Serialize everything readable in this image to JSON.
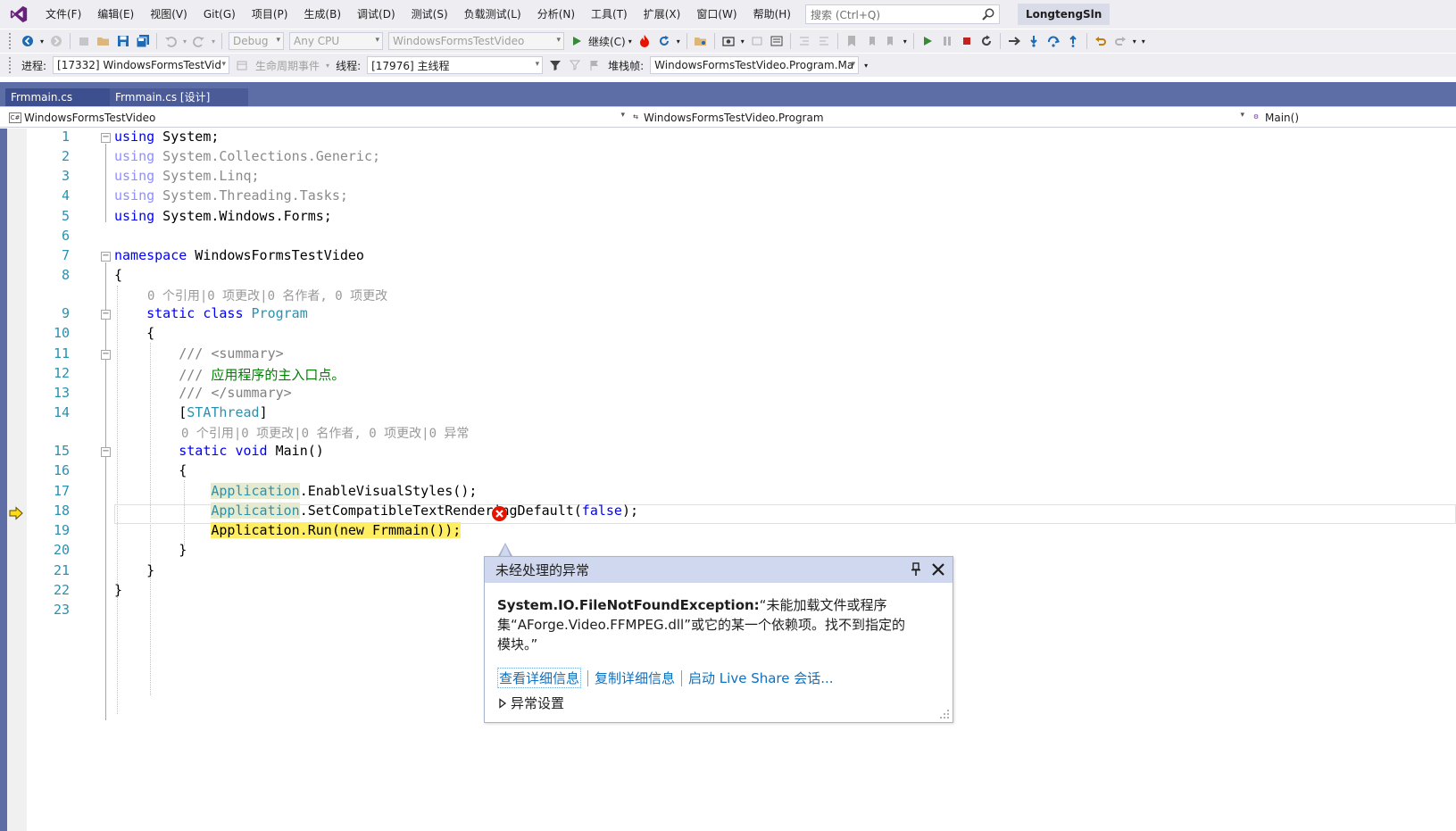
{
  "menu": [
    "文件(F)",
    "编辑(E)",
    "视图(V)",
    "Git(G)",
    "项目(P)",
    "生成(B)",
    "调试(D)",
    "测试(S)",
    "负载测试(L)",
    "分析(N)",
    "工具(T)",
    "扩展(X)",
    "窗口(W)",
    "帮助(H)"
  ],
  "search": {
    "placeholder": "搜索 (Ctrl+Q)"
  },
  "solution_name": "LongtengSln",
  "toolbar1": {
    "config": "Debug",
    "platform": "Any CPU",
    "startup_project": "WindowsFormsTestVideo",
    "continue_label": "继续(C)"
  },
  "toolbar2": {
    "process_label": "进程:",
    "process_value": "[17332] WindowsFormsTestVid",
    "lifecycle_label": "生命周期事件",
    "thread_label": "线程:",
    "thread_value": "[17976] 主线程",
    "stackframe_label": "堆栈帧:",
    "stackframe_value": "WindowsFormsTestVideo.Program.Ma"
  },
  "tabs": [
    "Frmmain.cs",
    "Frmmain.cs [设计]"
  ],
  "navbar": {
    "project": "WindowsFormsTestVideo",
    "type": "WindowsFormsTestVideo.Program",
    "member": "Main()"
  },
  "codelens": {
    "class": "0 个引用|0 项更改|0 名作者, 0 项更改",
    "main": "0 个引用|0 项更改|0 名作者, 0 项更改|0 异常"
  },
  "line_numbers": [
    "1",
    "2",
    "3",
    "4",
    "5",
    "6",
    "7",
    "8",
    "9",
    "10",
    "11",
    "12",
    "13",
    "14",
    "15",
    "16",
    "17",
    "18",
    "19",
    "20",
    "21",
    "22",
    "23"
  ],
  "exception_popup": {
    "title": "未经处理的异常",
    "exception_type": "System.IO.FileNotFoundException:",
    "message_line1": "“未能加载文件或程序",
    "message_line2": "集“AForge.Video.FFMPEG.dll”或它的某一个依赖项。找不到指定的",
    "message_line3": "模块。”",
    "link_details": "查看详细信息",
    "link_copy": "复制详细信息",
    "link_liveshare": "启动 Live Share 会话...",
    "settings": "异常设置"
  }
}
